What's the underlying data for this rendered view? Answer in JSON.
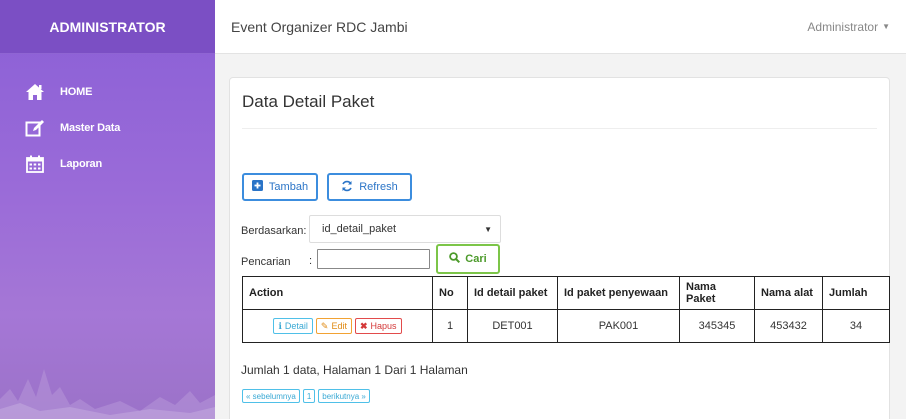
{
  "sidebar": {
    "brand": "ADMINISTRATOR",
    "items": [
      {
        "label": "HOME",
        "icon": "home-icon"
      },
      {
        "label": "Master Data",
        "icon": "edit-icon"
      },
      {
        "label": "Laporan",
        "icon": "calendar-icon"
      }
    ]
  },
  "topbar": {
    "title": "Event Organizer RDC Jambi",
    "user": "Administrator"
  },
  "panel": {
    "title": "Data Detail Paket",
    "tambah_label": "Tambah",
    "refresh_label": "Refresh",
    "filter": {
      "label": "Berdasarkan:",
      "selected": "id_detail_paket"
    },
    "search": {
      "label": "Pencarian",
      "colon": ":",
      "value": "",
      "button": "Cari"
    },
    "table": {
      "headers": [
        "Action",
        "No",
        "Id detail paket",
        "Id paket penyewaan",
        "Nama Paket",
        "Nama alat",
        "Jumlah"
      ],
      "actions": {
        "detail": "Detail",
        "edit": "Edit",
        "hapus": "Hapus"
      },
      "rows": [
        {
          "no": "1",
          "id_detail_paket": "DET001",
          "id_paket_penyewaan": "PAK001",
          "nama_paket": "345345",
          "nama_alat": "453432",
          "jumlah": "34"
        }
      ]
    },
    "summary": "Jumlah 1 data, Halaman 1 Dari 1 Halaman",
    "pager": {
      "prev": "« sebelumnya",
      "page": "1",
      "next": "berikutnya »"
    }
  },
  "colors": {
    "sidebar": "#8a5fd6",
    "brand_bg": "#7b4fc4",
    "primary": "#3c8dde",
    "success": "#7cc548",
    "info": "#4fc0e8",
    "warning": "#f2a233",
    "danger": "#e24b4b"
  }
}
